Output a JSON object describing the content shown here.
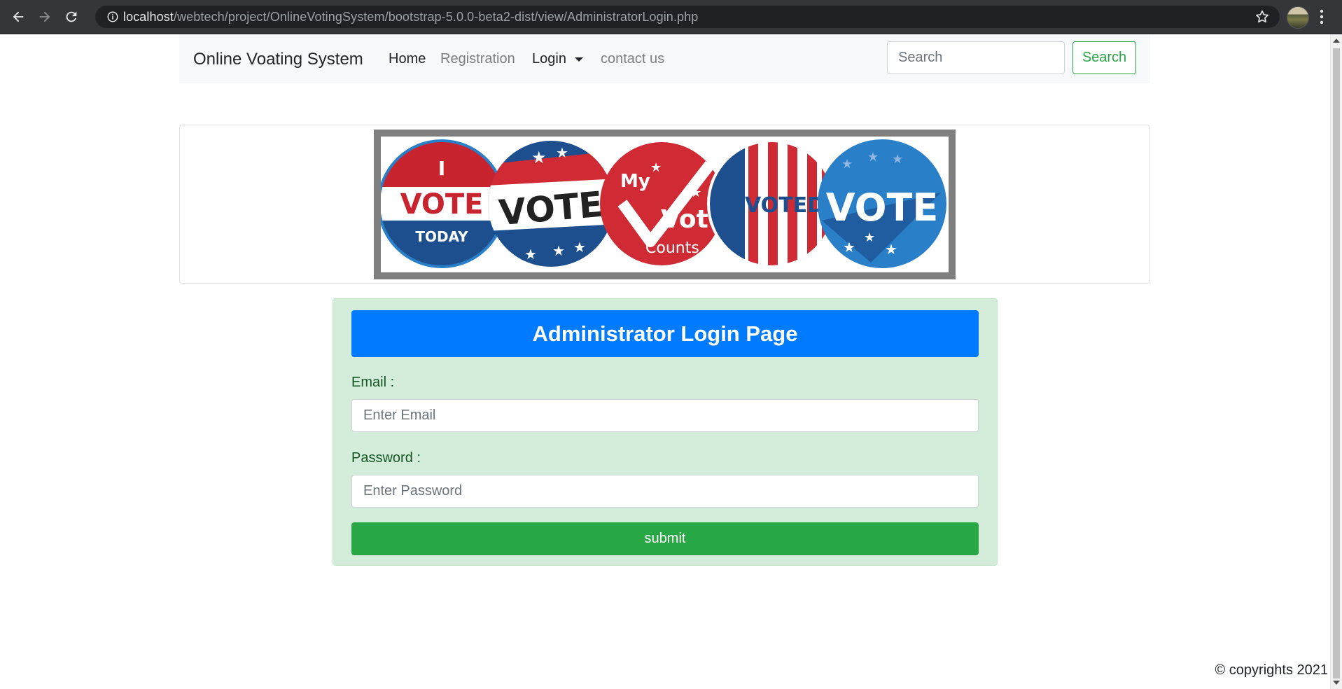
{
  "browser": {
    "url_host": "localhost",
    "url_path": "/webtech/project/OnlineVotingSystem/bootstrap-5.0.0-beta2-dist/view/AdministratorLogin.php"
  },
  "navbar": {
    "brand": "Online Voating System",
    "links": {
      "home": "Home",
      "registration": "Registration",
      "login": "Login",
      "contact": "contact us"
    },
    "search": {
      "placeholder": "Search",
      "button_label": "Search"
    }
  },
  "banner": {
    "buttons": [
      {
        "top": "I",
        "main": "VOTE",
        "bottom": "TODAY"
      },
      {
        "main": "VOTE"
      },
      {
        "top": "My",
        "main": "Vote",
        "bottom": "Counts"
      },
      {
        "main": "I★VOTED"
      },
      {
        "main": "VOTE"
      }
    ]
  },
  "login": {
    "title": "Administrator Login Page",
    "email_label": "Email :",
    "email_placeholder": "Enter Email",
    "password_label": "Password :",
    "password_placeholder": "Enter Password",
    "submit_label": "submit"
  },
  "footer": {
    "copyright": "© copyrights 2021"
  },
  "colors": {
    "primary": "#007bff",
    "success": "#28a745",
    "success_bg": "#d4edda",
    "navbar_bg": "#f8f9fa",
    "vote_red": "#d02a35",
    "vote_blue": "#1f5ea8"
  }
}
